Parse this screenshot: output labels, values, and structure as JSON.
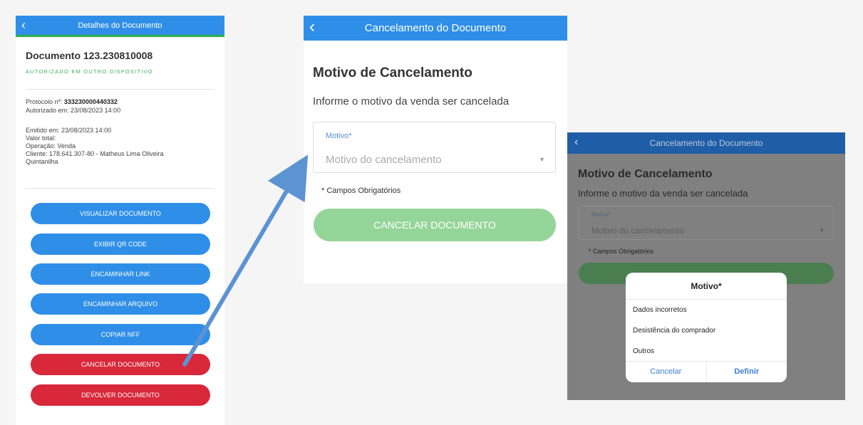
{
  "screen1": {
    "header_title": "Detalhes do Documento",
    "back_icon": "‹",
    "document_title": "Documento 123.230810008",
    "status": "AUTORIZADO EM OUTRO DISPOSITIVO",
    "protocol_label": "Protocolo nº: ",
    "protocol_value": "333230000440332",
    "authorized_at": "Autorizado em: 23/08/2023 14:00",
    "issued_at": "Emitido em: 23/08/2023 14:00",
    "total_value": "Valor total:",
    "operation": "Operação: Venda",
    "client_line1": "Cliente: 178.641.307-80 - Matheus Lima Oliveira",
    "client_line2": "Quintanilha",
    "buttons": {
      "view": "VISUALIZAR DOCUMENTO",
      "qr": "EXIBIR QR CODE",
      "link": "ENCAMINHAR LINK",
      "file": "ENCAMINHAR ARQUIVO",
      "copy": "COPIAR NFF",
      "cancel": "CANCELAR DOCUMENTO",
      "return": "DEVOLVER DOCUMENTO"
    },
    "colors": {
      "primary": "#2f8fe8",
      "danger": "#d8283a",
      "success": "#3db15a"
    }
  },
  "screen2": {
    "header_title": "Cancelamento do Documento",
    "back_icon": "‹",
    "title": "Motivo de Cancelamento",
    "subtitle": "Informe o motivo da venda ser cancelada",
    "select_label": "Motivo*",
    "select_placeholder": "Motivo do cancelamento",
    "caret_icon": "▼",
    "required_note": "* Campos Obrigatórios",
    "cancel_button": "CANCELAR DOCUMENTO"
  },
  "screen3": {
    "header_title": "Cancelamento do Documento",
    "back_icon": "‹",
    "title": "Motivo de Cancelamento",
    "subtitle": "Informe o motivo da venda ser cancelada",
    "select_label": "Motivo*",
    "select_placeholder": "Motivo do cancelamento",
    "caret_icon": "▼",
    "required_note": "* Campos Obrigatórios",
    "dialog": {
      "title": "Motivo*",
      "options": [
        "Dados incorretos",
        "Desistência do comprador",
        "Outros"
      ],
      "cancel": "Cancelar",
      "confirm": "Definir"
    }
  }
}
